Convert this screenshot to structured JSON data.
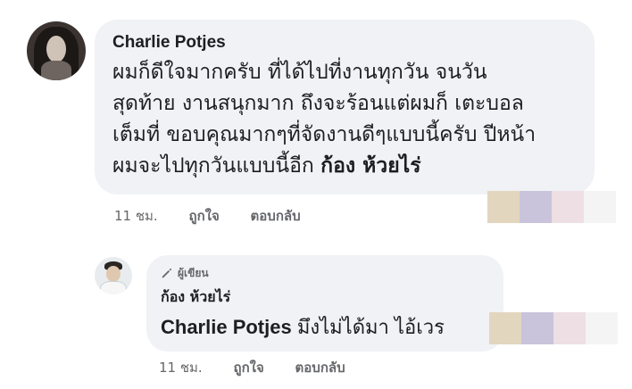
{
  "comments": [
    {
      "author": "Charlie Potjes",
      "text_lines": [
        "ผมก็ดีใจมากครับ ที่ได้ไปที่งานทุกวัน จนวัน",
        "สุดท้าย งานสนุกมาก ถึงจะร้อนแต่ผมก็ เตะบอล",
        "เต็มที่ ขอบคุณมากๆที่จัดงานดีๆแบบนี้ครับ ปีหน้า",
        "ผมจะไปทุกวันแบบนี้อีก "
      ],
      "mention": "ก้อง ห้วยไร่",
      "time": "11 ชม.",
      "like_label": "ถูกใจ",
      "reply_label": "ตอบกลับ"
    },
    {
      "badge": "ผู้เขียน",
      "author": "ก้อง ห้วยไร่",
      "mention": "Charlie Potjes",
      "text": " มึงไม่ได้มา ไอ้เวร",
      "time": "11 ชม.",
      "like_label": "ถูกใจ",
      "reply_label": "ตอบกลับ"
    }
  ],
  "swatch_colors": [
    "#e3d6bf",
    "#c9c4dc",
    "#eddfe3",
    "#f4f4f4"
  ],
  "colors": {
    "bubble": "#f0f2f5",
    "meta_text": "#65676b",
    "text": "#1c1e21"
  }
}
